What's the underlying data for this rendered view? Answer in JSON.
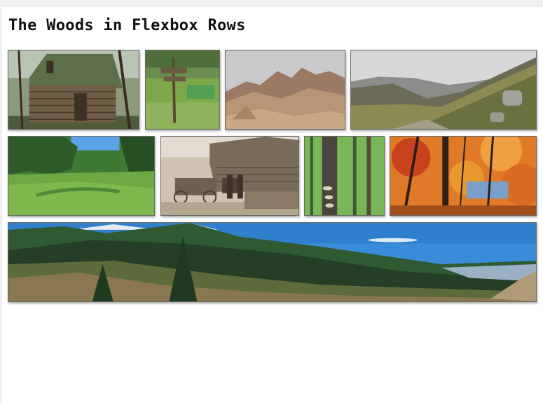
{
  "page": {
    "title": "The Woods in Flexbox Rows"
  },
  "gallery": {
    "photos": [
      {
        "name": "log-cabin-photo",
        "subject": "old log cabin in the woods"
      },
      {
        "name": "trail-sign-photo",
        "subject": "wooden trail sign in meadow"
      },
      {
        "name": "rocky-mountains-photo",
        "subject": "rocky mountain peaks"
      },
      {
        "name": "misty-hillside-photo",
        "subject": "misty hillside with boulders"
      },
      {
        "name": "forest-meadow-photo",
        "subject": "green meadow with pine forest"
      },
      {
        "name": "horse-wagon-cabin-photo",
        "subject": "vintage photo of horse wagon by cabin"
      },
      {
        "name": "birch-forest-photo",
        "subject": "green forest with fungus on tree trunk"
      },
      {
        "name": "autumn-forest-photo",
        "subject": "autumn forest with orange leaves"
      },
      {
        "name": "mountain-panorama-photo",
        "subject": "panoramic view of forested mountain slopes"
      }
    ]
  }
}
